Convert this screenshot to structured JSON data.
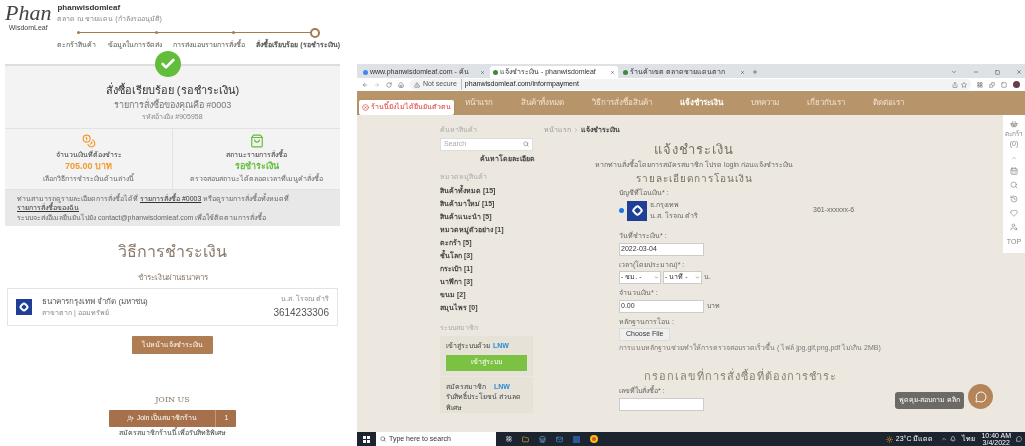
{
  "order_page": {
    "logo": {
      "script": "Phan",
      "sub": "WisdomLeaf"
    },
    "store_name": "phanwisdomleaf",
    "store_subtitle": "ตลาด ณ ชายแดน (กำลังรออนุมัติ)",
    "steps": [
      {
        "label": "ตะกร้าสินค้า",
        "current": false
      },
      {
        "label": "ข้อมูลในการจัดส่ง",
        "current": false
      },
      {
        "label": "การส่งมอบรายการสั่งซื้อ",
        "current": false
      },
      {
        "label": "สั่งซื้อเรียบร้อย (รอชำระเงิน)",
        "current": true
      }
    ],
    "confirmation": {
      "title": "สั่งซื้อเรียบร้อย (รอชำระเงิน)",
      "order_line": "รายการสั่งซื้อของคุณคือ #0003",
      "reference": "รหัสอ้างอิง #905958"
    },
    "amount": {
      "label": "จำนวนเงินที่ต้องชำระ",
      "value": "705.00 บาท",
      "note": "เลือกวิธีการชำระเงินด้านล่างนี้"
    },
    "status": {
      "label": "สถานะรายการสั่งซื้อ",
      "value": "รอชำระเงิน",
      "note": "ตรวจสอบสถานะได้ตลอดเวลาที่เมนูคำสั่งซื้อ"
    },
    "footnote": {
      "before": "ท่านสามารถดูรายละเอียดการสั่งซื้อได้ที่",
      "link1": "รายการสั่งซื้อ #0003",
      "middle": "หรือดูรายการสั่งซื้อทั้งหมดที่",
      "link2": "รายการสั่งซื้อของฉัน",
      "second": "ระบบจะส่งอีเมลยืนยันไปยัง contact@phanwisdomleaf.com เพื่อใช้ติดตามการสั่งซื้อ"
    },
    "payment_title": "วิธีการชำระเงิน",
    "bank_section": "ชำระเงินผ่านธนาคาร",
    "bank": {
      "name": "ธนาคารกรุงเทพ จำกัด (มหาชน)",
      "branch": "สาขาตาก | ออมทรัพย์",
      "holder": "น.ส. โรจณ ตำริ",
      "account": "3614233306"
    },
    "inform_button": "ไปหน้าแจ้งชำระเงิน",
    "join_title": "JOIN US",
    "join_button": "Join เป็นสมาชิกร้าน",
    "join_count": "1",
    "join_note": "สมัครสมาชิกร้านนี้ เพื่อรับสิทธิพิเศษ"
  },
  "browser": {
    "tabs": [
      {
        "title": "www.phanwisdomleaf.com - ค้น",
        "selected": false
      },
      {
        "title": "แจ้งชำระเงิน - phanwisdomleaf",
        "selected": true
      },
      {
        "title": "ร้านค้าเขต ตลาดชายแดนตาก",
        "selected": false
      }
    ],
    "address": {
      "warning": "Not secure",
      "url": "phanwisdomleaf.com/informpayment"
    },
    "nav": [
      {
        "label": "หน้าแรก",
        "selected": false
      },
      {
        "label": "สินค้าทั้งหมด",
        "selected": false
      },
      {
        "label": "วิธีการสั่งซื้อสินค้า",
        "selected": false
      },
      {
        "label": "แจ้งชำระเงิน",
        "selected": true
      },
      {
        "label": "บทความ",
        "selected": false
      },
      {
        "label": "เกี่ยวกับเรา",
        "selected": false
      },
      {
        "label": "ติดต่อเรา",
        "selected": false
      }
    ],
    "notice": "ร้านนี้ยังไม่ได้ยืนยันตัวตน",
    "sidebar": {
      "search_heading": "ค้นหาสินค้า",
      "search_placeholder": "Search",
      "advanced_link": "ค้นหาโดยละเอียด",
      "categories_heading": "หมวดหมู่สินค้า",
      "categories": [
        "สินค้าทั้งหมด [15]",
        "สินค้ามาใหม่ [15]",
        "สินค้าแนะนำ [5]",
        "หมวดหมู่ตัวอย่าง [1]",
        "ตะกร้า [5]",
        "ชั้นโลก [3]",
        "กระเป๋า [1]",
        "นาฬิกา [3]",
        "ขนม [2]",
        "สมุนไพร [0]"
      ],
      "member_heading": "ระบบสมาชิก",
      "login_label": "เข้าสู่ระบบด้วย",
      "login_brand": "LNW",
      "login_button": "เข้าสู่ระบบ",
      "signup_label": "สมัครสมาชิก",
      "signup_brand": "LNW",
      "signup_note": "รับสิทธิ์ประโยชน์ ส่วนลดพิเศษ"
    },
    "breadcrumb": [
      "หน้าแรก",
      "แจ้งชำระเงิน"
    ],
    "form": {
      "title": "แจ้งชำระเงิน",
      "intro": "หากท่านสั่งซื้อโดยการสมัครสมาชิก โปรด login ก่อนแจ้งชำระเงิน",
      "details_title": "รายละเอียดการโอนเงิน",
      "account_label": "บัญชีที่โอนเงิน* :",
      "accounts": [
        {
          "bank": "ธ.กรุงเทพ",
          "holder": "น.ส. โรจณ ตำริ",
          "number": "361-xxxxxx-6",
          "selected": true
        }
      ],
      "date_label": "วันที่ชำระเงิน* :",
      "date_value": "2022-03-04",
      "time_label": "เวลา(โดยประมาณ)* :",
      "hour": "- ชม. -",
      "minute": "- นาที -",
      "time_unit": "น.",
      "amount_label": "จำนวนเงิน* :",
      "amount_value": "0.00",
      "amount_unit": "บาท",
      "proof_label": "หลักฐานการโอน :",
      "file_button": "Choose File",
      "proof_hint": "การแนบหลักฐานช่วยทำให้การตรวจสอบรวดเร็วขึ้น ( ไฟล์ jpg,gif,png,pdf ไม่เกิน 2MB)",
      "order_title": "กรอกเลขที่การสั่งซื้อที่ต้องการชำระ",
      "order_label": "เลขที่ใบสั่งซื้อ* :"
    },
    "rail": {
      "cart_label": "ตะกร้า",
      "cart_count": "(0)",
      "top_label": "TOP"
    },
    "chat_label": "พูดคุย-สอบถาม คลิก"
  },
  "taskbar": {
    "search_placeholder": "Type here to search",
    "weather": "23°C มีแดด",
    "language": "ไทย",
    "time": "10:40 AM",
    "date": "3/4/2022"
  }
}
